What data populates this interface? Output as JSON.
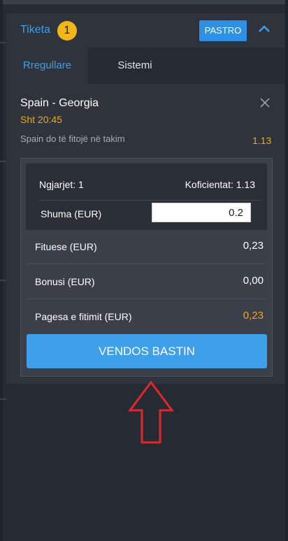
{
  "header": {
    "title": "Tiketa",
    "badge_count": "1",
    "clear_label": "PASTRO",
    "collapse_icon": "chevron-up-icon"
  },
  "tabs": [
    {
      "label": "Rregullare",
      "active": true
    },
    {
      "label": "Sistemi",
      "active": false
    }
  ],
  "selection": {
    "match": "Spain - Georgia",
    "time": "Sht 20:45",
    "pick": "Spain do të fitojë në takim",
    "odds": "1.13",
    "remove_icon": "close-icon"
  },
  "summary": {
    "events_label": "Ngjarjet: 1",
    "coef_label": "Koficientat: 1.13",
    "stake_label": "Shuma (EUR)",
    "stake_value": "0.2"
  },
  "totals": {
    "win_label": "Fituese (EUR)",
    "win_value": "0,23",
    "bonus_label": "Bonusi (EUR)",
    "bonus_value": "0,00",
    "payout_label": "Pagesa e fitimit (EUR)",
    "payout_value": "0,23"
  },
  "place_bet_label": "VENDOS BASTIN",
  "colors": {
    "accent": "#3ea0ea",
    "gold": "#f2a71b",
    "badge": "#f2b617",
    "annotation_arrow": "#e3262b"
  }
}
